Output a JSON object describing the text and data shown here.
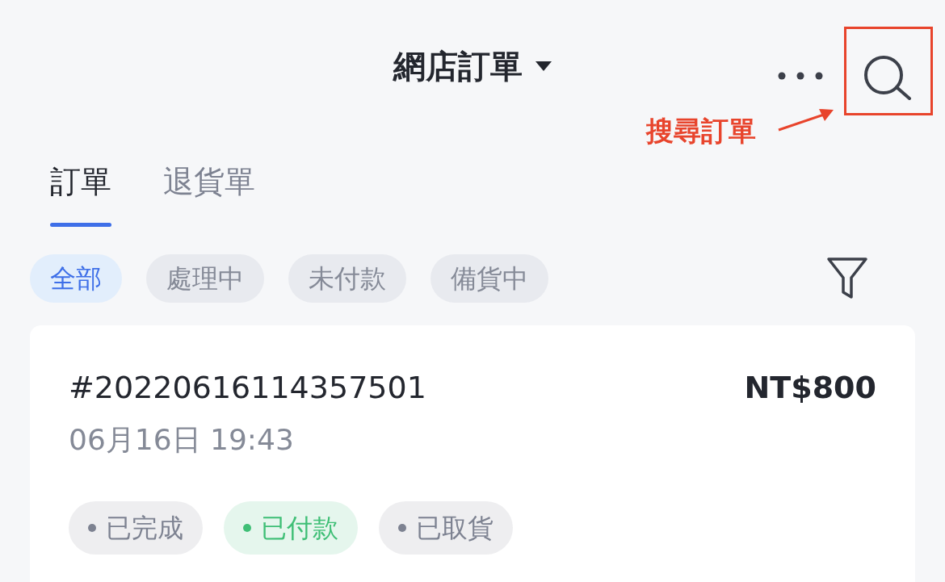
{
  "header": {
    "title": "網店訂單",
    "annotation": "搜尋訂單"
  },
  "tabs": [
    {
      "label": "訂單",
      "selected": true
    },
    {
      "label": "退貨單",
      "selected": false
    }
  ],
  "filters": [
    {
      "label": "全部",
      "selected": true
    },
    {
      "label": "處理中",
      "selected": false
    },
    {
      "label": "未付款",
      "selected": false
    },
    {
      "label": "備貨中",
      "selected": false
    }
  ],
  "orders": [
    {
      "number": "#20220616114357501",
      "amount": "NT$800",
      "date": "06月16日 19:43",
      "tags": [
        {
          "label": "已完成",
          "color": "#7d8291"
        },
        {
          "label": "已付款",
          "color": "#3fbf76"
        },
        {
          "label": "已取貨",
          "color": "#7d8291"
        }
      ]
    }
  ]
}
